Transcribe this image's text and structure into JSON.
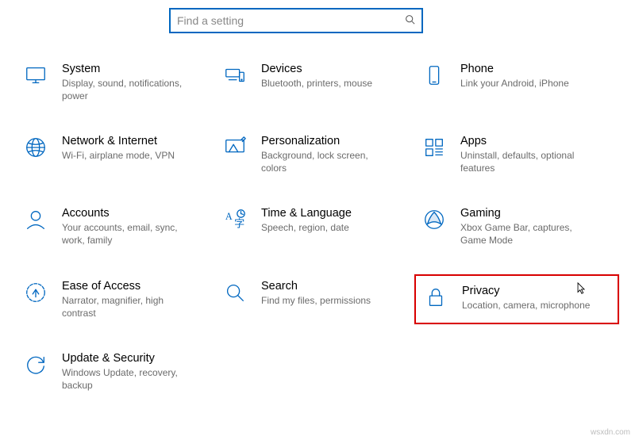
{
  "search": {
    "placeholder": "Find a setting"
  },
  "categories": [
    {
      "key": "system",
      "title": "System",
      "desc": "Display, sound, notifications, power"
    },
    {
      "key": "devices",
      "title": "Devices",
      "desc": "Bluetooth, printers, mouse"
    },
    {
      "key": "phone",
      "title": "Phone",
      "desc": "Link your Android, iPhone"
    },
    {
      "key": "network",
      "title": "Network & Internet",
      "desc": "Wi-Fi, airplane mode, VPN"
    },
    {
      "key": "personalization",
      "title": "Personalization",
      "desc": "Background, lock screen, colors"
    },
    {
      "key": "apps",
      "title": "Apps",
      "desc": "Uninstall, defaults, optional features"
    },
    {
      "key": "accounts",
      "title": "Accounts",
      "desc": "Your accounts, email, sync, work, family"
    },
    {
      "key": "time",
      "title": "Time & Language",
      "desc": "Speech, region, date"
    },
    {
      "key": "gaming",
      "title": "Gaming",
      "desc": "Xbox Game Bar, captures, Game Mode"
    },
    {
      "key": "ease",
      "title": "Ease of Access",
      "desc": "Narrator, magnifier, high contrast"
    },
    {
      "key": "search_cat",
      "title": "Search",
      "desc": "Find my files, permissions"
    },
    {
      "key": "privacy",
      "title": "Privacy",
      "desc": "Location, camera, microphone"
    },
    {
      "key": "update",
      "title": "Update & Security",
      "desc": "Windows Update, recovery, backup"
    }
  ],
  "watermark": "wsxdn.com",
  "highlighted_key": "privacy",
  "accent": "#0067c0"
}
